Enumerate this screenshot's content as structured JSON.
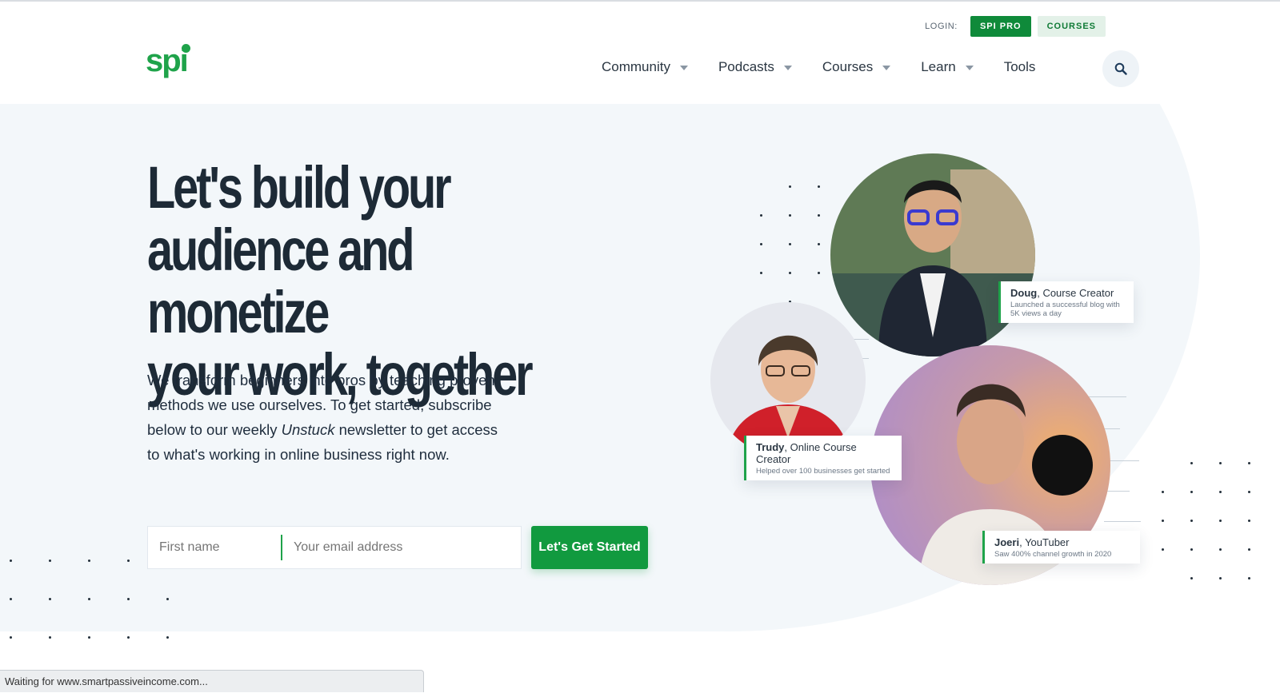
{
  "header": {
    "login_label": "LOGIN:",
    "spi_pro_label": "SPI PRO",
    "courses_button_label": "COURSES",
    "logo_text": "spi",
    "nav": [
      {
        "label": "Community",
        "dropdown": true
      },
      {
        "label": "Podcasts",
        "dropdown": true
      },
      {
        "label": "Courses",
        "dropdown": true
      },
      {
        "label": "Learn",
        "dropdown": true
      },
      {
        "label": "Tools",
        "dropdown": false
      }
    ],
    "search_icon": "search-icon"
  },
  "hero": {
    "headline_line1": "Let's build your",
    "headline_line2": "audience and monetize",
    "headline_line3": "your work, together",
    "subtext_before": "We transform beginners into pros by teaching proven methods we use ourselves. To get started, subscribe below to our weekly ",
    "subtext_italic": "Unstuck",
    "subtext_after": " newsletter to get access to what's working in online business right now.",
    "form": {
      "first_name_placeholder": "First name",
      "email_placeholder": "Your email address",
      "submit_label": "Let's Get Started"
    }
  },
  "testimonials": [
    {
      "name": "Doug",
      "role": ", Course Creator",
      "desc": "Launched a successful blog with 5K views a day"
    },
    {
      "name": "Trudy",
      "role": ", Online Course Creator",
      "desc": "Helped over 100 businesses get started"
    },
    {
      "name": "Joeri",
      "role": ", YouTuber",
      "desc": "Saw 400% channel growth in 2020"
    }
  ],
  "status_bar": {
    "text": "Waiting for www.smartpassiveincome.com..."
  },
  "colors": {
    "brand_green": "#1fa34a",
    "button_green": "#119a3f",
    "hero_bg": "#f3f7fa",
    "text_dark": "#1d2a36"
  }
}
